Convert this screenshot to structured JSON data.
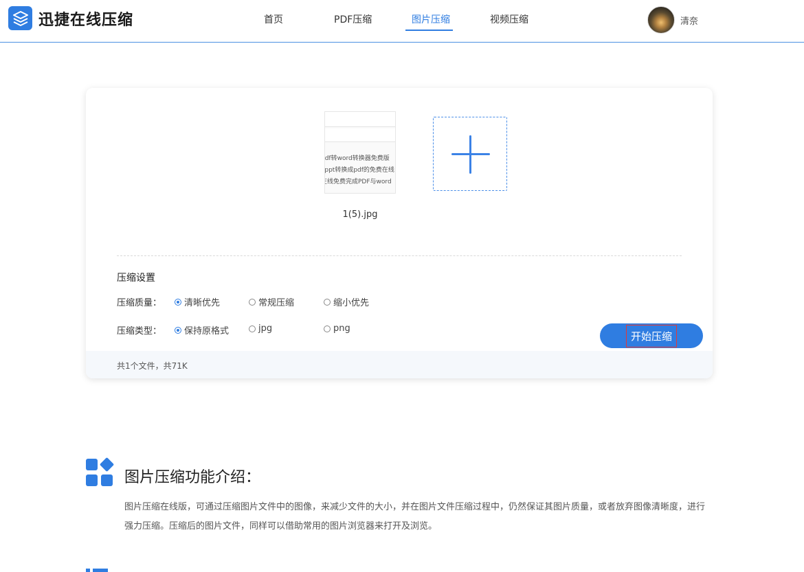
{
  "header": {
    "logo_text": "迅捷在线压缩",
    "nav": [
      "首页",
      "PDF压缩",
      "图片压缩",
      "视频压缩"
    ],
    "active_nav": "图片压缩",
    "user_name": "清奈"
  },
  "upload": {
    "thumbnail_lines": [
      "pdf转word转换器免费版",
      "f.ppt转换成pdf的免费在线",
      "在线免费完成PDF与word"
    ],
    "file_name": "1(5).jpg"
  },
  "settings": {
    "title": "压缩设置",
    "quality": {
      "label": "压缩质量：",
      "options": [
        "清晰优先",
        "常规压缩",
        "缩小优先"
      ],
      "selected": "清晰优先"
    },
    "type": {
      "label": "压缩类型：",
      "options": [
        "保持原格式",
        "jpg",
        "png"
      ],
      "selected": "保持原格式"
    },
    "start_button": "开始压缩",
    "summary": "共1个文件，共71K"
  },
  "intro": {
    "title": "图片压缩功能介绍：",
    "text": "图片压缩在线版，可通过压缩图片文件中的图像，来减少文件的大小，并在图片文件压缩过程中，仍然保证其图片质量，或者放弃图像清晰度，进行强力压缩。压缩后的图片文件，同样可以借助常用的图片浏览器来打开及浏览。"
  },
  "colors": {
    "accent": "#2f7de1",
    "button_outline": "#e53935"
  }
}
